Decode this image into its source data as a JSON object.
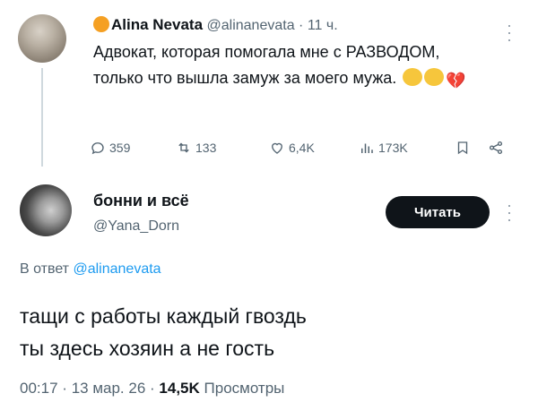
{
  "tweet1": {
    "display_name": "Alina Nevata",
    "handle": "@alinanevata",
    "separator": "·",
    "time": "11 ч.",
    "text": "Адвокат, которая помогала мне с РАЗВОДОМ, только что вышла замуж за моего мужа.",
    "emojis": [
      "crying-face",
      "crying-face",
      "broken-heart"
    ],
    "actions": {
      "replies": "359",
      "reposts": "133",
      "likes": "6,4K",
      "views": "173K"
    }
  },
  "tweet2": {
    "display_name": "бонни и всё",
    "handle": "@Yana_Dorn",
    "read_button": "Читать",
    "reply_prefix": "В ответ",
    "reply_handle": "@alinanevata",
    "text_line1": "тащи с работы каждый гвоздь",
    "text_line2": "ты здесь хозяин а не гость",
    "meta": {
      "time": "00:17",
      "sep1": "·",
      "date": "13 мар. 26",
      "sep2": "·",
      "views_count": "14,5K",
      "views_label": "Просмотры"
    }
  },
  "colors": {
    "text": "#0f1419",
    "muted": "#536471",
    "link": "#1d9bf0",
    "button_bg": "#0f1419"
  }
}
